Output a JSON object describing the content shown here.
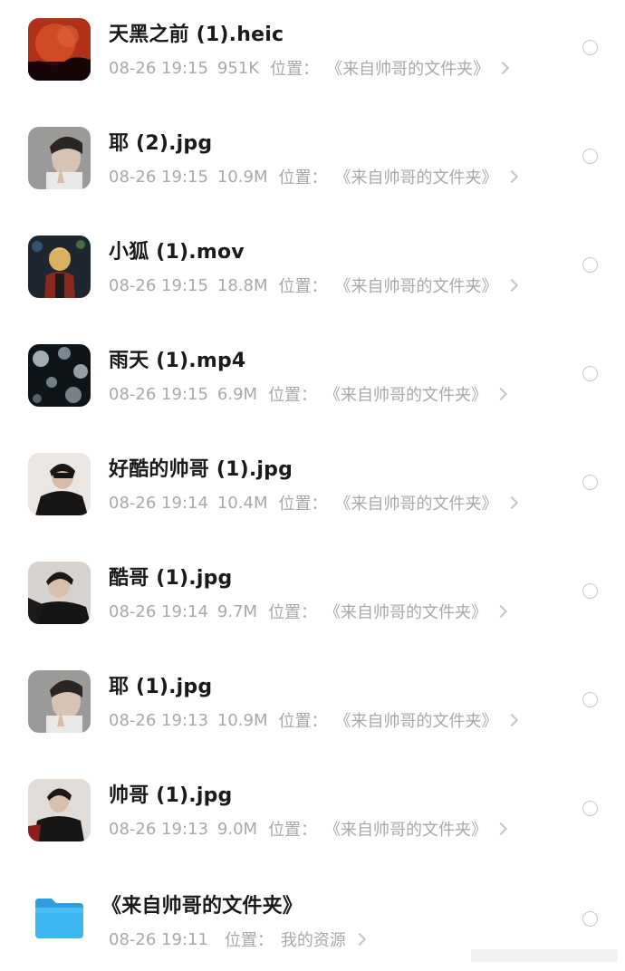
{
  "files": [
    {
      "name": "天黑之前 (1).heic",
      "date": "08-26 19:15",
      "size": "951K",
      "location_label": "位置：",
      "location": "《来自帅哥的文件夹》",
      "thumbnail": "sunset-photo-thumbnail"
    },
    {
      "name": "耶 (2).jpg",
      "date": "08-26 19:15",
      "size": "10.9M",
      "location_label": "位置：",
      "location": "《来自帅哥的文件夹》",
      "thumbnail": "portrait-photo-thumbnail"
    },
    {
      "name": "小狐 (1).mov",
      "date": "08-26 19:15",
      "size": "18.8M",
      "location_label": "位置：",
      "location": "《来自帅哥的文件夹》",
      "thumbnail": "video-thumbnail"
    },
    {
      "name": "雨天 (1).mp4",
      "date": "08-26 19:15",
      "size": "6.9M",
      "location_label": "位置：",
      "location": "《来自帅哥的文件夹》",
      "thumbnail": "video-thumbnail"
    },
    {
      "name": "好酷的帅哥 (1).jpg",
      "date": "08-26 19:14",
      "size": "10.4M",
      "location_label": "位置：",
      "location": "《来自帅哥的文件夹》",
      "thumbnail": "portrait-photo-thumbnail"
    },
    {
      "name": "酷哥 (1).jpg",
      "date": "08-26 19:14",
      "size": "9.7M",
      "location_label": "位置：",
      "location": "《来自帅哥的文件夹》",
      "thumbnail": "portrait-photo-thumbnail"
    },
    {
      "name": "耶 (1).jpg",
      "date": "08-26 19:13",
      "size": "10.9M",
      "location_label": "位置：",
      "location": "《来自帅哥的文件夹》",
      "thumbnail": "portrait-photo-thumbnail"
    },
    {
      "name": "帅哥 (1).jpg",
      "date": "08-26 19:13",
      "size": "9.0M",
      "location_label": "位置：",
      "location": "《来自帅哥的文件夹》",
      "thumbnail": "portrait-photo-thumbnail"
    }
  ],
  "folder": {
    "name": "《来自帅哥的文件夹》",
    "date": "08-26 19:11",
    "location_label": "位置：",
    "location": "我的资源",
    "icon": "folder-icon",
    "icon_color": "#3ab4f2"
  },
  "colors": {
    "text_primary": "#1a1a1a",
    "text_secondary": "#a8a8a8",
    "radio_border": "#c6c6c6"
  }
}
